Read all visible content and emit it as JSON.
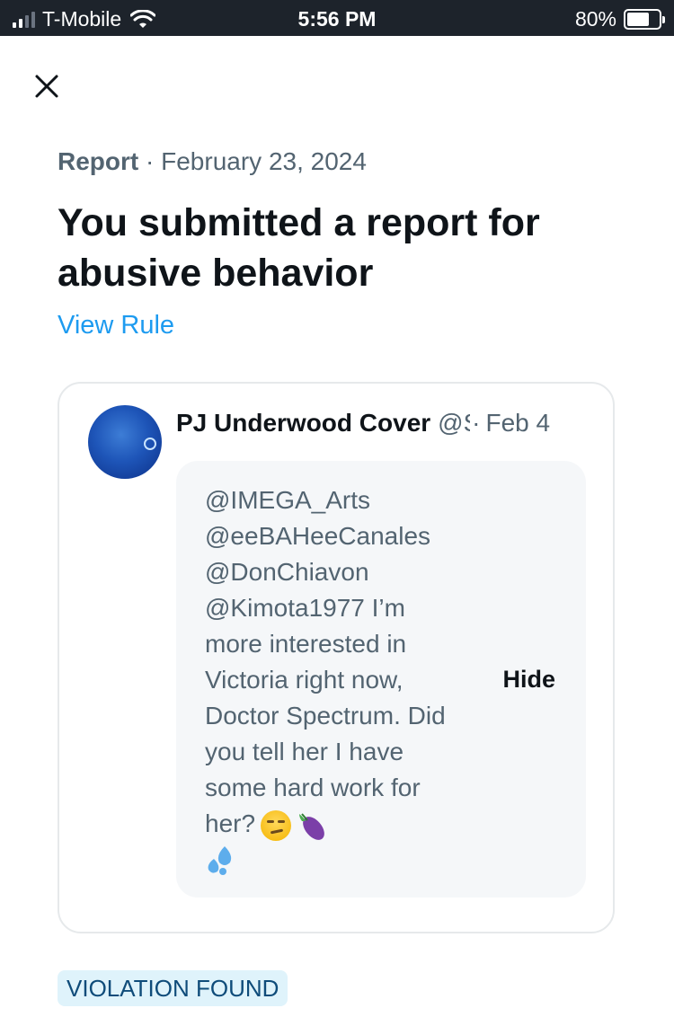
{
  "status_bar": {
    "carrier": "T-Mobile",
    "time": "5:56 PM",
    "battery_percent": "80%",
    "battery_level": 0.8,
    "signal_bars": 2,
    "wifi_icon": "wifi-icon"
  },
  "header": {
    "close_icon": "close-icon"
  },
  "report": {
    "label": "Report",
    "separator": "·",
    "date": "February 23, 2024",
    "title": "You submitted a report for abusive behavior",
    "view_rule": "View Rule"
  },
  "tweet": {
    "author_name": "PJ Underwood Cover",
    "handle": "@S",
    "separator": "·",
    "date": "Feb 4",
    "text": "@IMEGA_Arts @eeBAHeeCanales @DonChiavon @Kimota1977 I’m more interested in Victoria right now, Doctor Spectrum. Did you tell her I have some hard work for her?",
    "emojis": [
      "smirking-face-emoji",
      "eggplant-emoji",
      "sweat-droplets-emoji"
    ],
    "hide_label": "Hide"
  },
  "status": {
    "badge": "VIOLATION FOUND",
    "accent": "#1d9bf0",
    "badge_bg": "#dff3fb"
  }
}
